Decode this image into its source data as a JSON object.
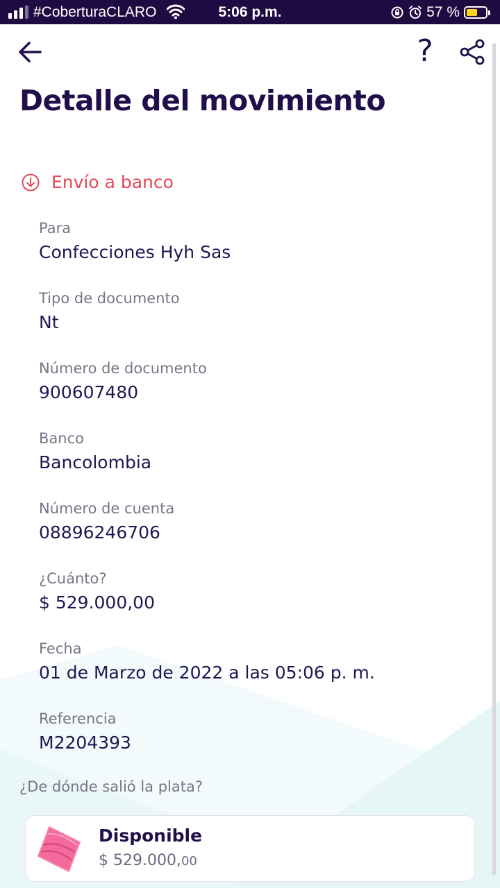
{
  "status_bar": {
    "carrier": "#CoberturaCLARO",
    "time": "5:06 p.m.",
    "battery_percent": "57 %",
    "battery_level": 0.57,
    "battery_color": "#ffd21f"
  },
  "header": {
    "back_icon": "arrow-left-icon",
    "help_label": "?",
    "share_icon": "share-icon"
  },
  "page_title": "Detalle del movimiento",
  "movement_type": {
    "icon": "arrow-down-circle-icon",
    "label": "Envío a banco",
    "color": "#e2495a"
  },
  "fields": [
    {
      "label": "Para",
      "value": "Confecciones Hyh Sas"
    },
    {
      "label": "Tipo de documento",
      "value": "Nt"
    },
    {
      "label": "Número de documento",
      "value": "900607480"
    },
    {
      "label": "Banco",
      "value": "Bancolombia"
    },
    {
      "label": "Número de cuenta",
      "value": "08896246706"
    },
    {
      "label": "¿Cuánto?",
      "value": "$ 529.000,00"
    },
    {
      "label": "Fecha",
      "value": "01 de Marzo de 2022 a las 05:06 p. m."
    },
    {
      "label": "Referencia",
      "value": "M2204393"
    }
  ],
  "source": {
    "question": "¿De dónde salió la plata?",
    "pocket_name": "Disponible",
    "amount_main": "$ 529.000,",
    "amount_cents": "00",
    "pocket_icon": "pocket-icon"
  },
  "colors": {
    "primary": "#200f4b",
    "status_bar": "#200a42",
    "accent_red": "#e2495a",
    "pocket_pink": "#f26b9c"
  }
}
